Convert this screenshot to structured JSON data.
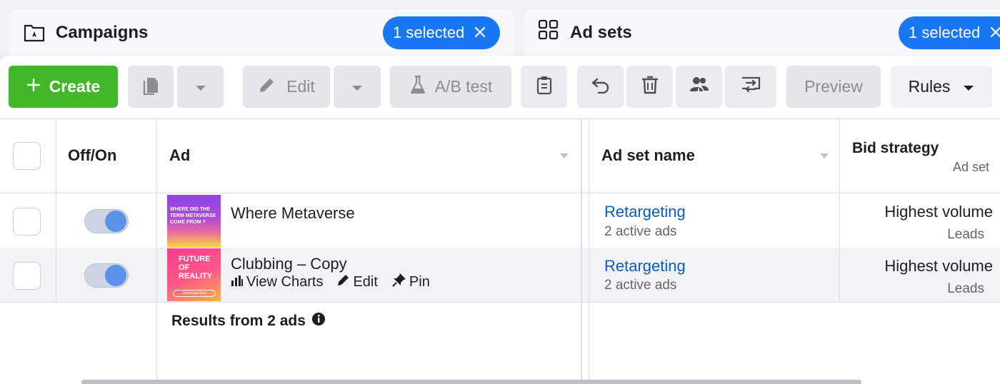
{
  "tabs": {
    "campaigns": {
      "title": "Campaigns",
      "selected": "1 selected"
    },
    "adsets": {
      "title": "Ad sets",
      "selected": "1 selected"
    }
  },
  "toolbar": {
    "create_label": "Create",
    "edit_label": "Edit",
    "ab_label": "A/B test",
    "preview_label": "Preview",
    "rules_label": "Rules"
  },
  "table": {
    "headers": {
      "off_on": "Off/On",
      "ad": "Ad",
      "ad_set_name": "Ad set name",
      "bid_strategy": "Bid strategy",
      "bid_strategy_sub": "Ad set"
    },
    "rows": [
      {
        "ad_name": "Where Metaverse",
        "ad_set_name": "Retargeting",
        "ad_set_sub": "2 active ads",
        "bid_strategy": "Highest volume",
        "bid_sub": "Leads",
        "toggle_on": true
      },
      {
        "ad_name": "Clubbing – Copy",
        "ad_set_name": "Retargeting",
        "ad_set_sub": "2 active ads",
        "bid_strategy": "Highest volume",
        "bid_sub": "Leads",
        "toggle_on": true,
        "actions": {
          "view_charts": "View Charts",
          "edit": "Edit",
          "pin": "Pin"
        }
      }
    ],
    "results_label": "Results from 2 ads"
  },
  "thumbnails": {
    "thumb1_text": "WHERE DID THE TERM METAVERSE COME FROM ?",
    "thumb2_title": "FUTURE OF REALITY",
    "thumb2_cta": "Download Now"
  },
  "colors": {
    "accent": "#1877f2",
    "create": "#42b72a",
    "link": "#0b5cbf"
  }
}
